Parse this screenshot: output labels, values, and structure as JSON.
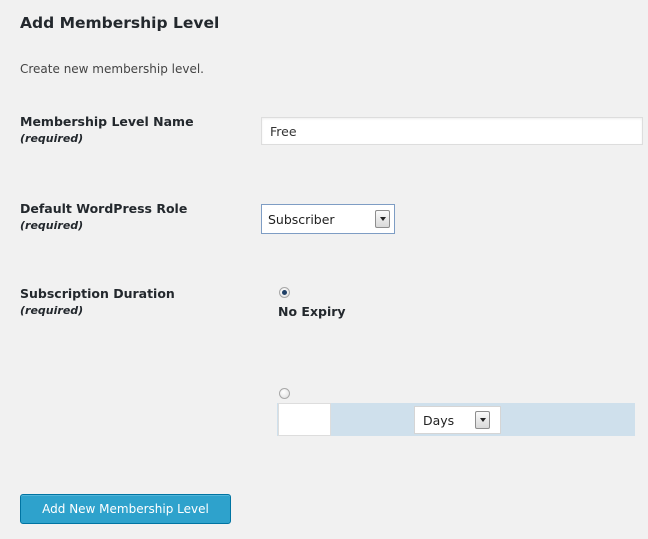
{
  "page": {
    "title": "Add Membership Level",
    "description": "Create new membership level."
  },
  "fields": {
    "level_name": {
      "label": "Membership Level Name",
      "required": "(required)",
      "value": "Free"
    },
    "role": {
      "label": "Default WordPress Role",
      "required": "(required)",
      "selected": "Subscriber"
    },
    "duration": {
      "label": "Subscription Duration",
      "required": "(required)",
      "no_expiry_label": "No Expiry",
      "no_expiry_checked": true,
      "days_value": "",
      "days_unit": "Days"
    }
  },
  "submit_label": "Add New Membership Level",
  "colors": {
    "background": "#f1f1f1",
    "button": "#2ea2cc",
    "days_panel": "#cfe0ec"
  },
  "icons": {
    "select_arrow": "chevron-down-icon"
  }
}
